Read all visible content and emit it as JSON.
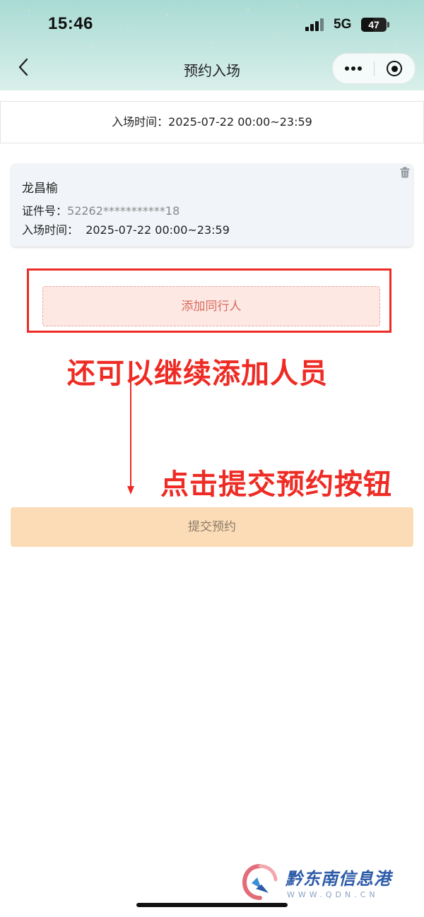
{
  "status_bar": {
    "time": "15:46",
    "network": "5G",
    "battery": "47",
    "battery_level": 0.47
  },
  "nav": {
    "title": "预约入场",
    "back_icon": "chevron-left-icon",
    "more_icon": "more-dots-icon",
    "close_icon": "target-circle-icon"
  },
  "entry_time": {
    "label": "入场时间：",
    "value": "2025-07-22 00:00~23:59"
  },
  "visitor": {
    "name": "龙昌榆",
    "id_label": "证件号：",
    "id_value": "52262***********18",
    "time_label": "入场时间：",
    "time_value": "2025-07-22 00:00~23:59",
    "delete_icon": "trash-icon"
  },
  "buttons": {
    "add_companion": "添加同行人",
    "submit": "提交预约"
  },
  "annotations": {
    "continue_adding": "还可以继续添加人员",
    "click_submit": "点击提交预约按钮"
  },
  "watermark": {
    "name": "黔东南信息港",
    "url": "WWW.QDN.CN"
  },
  "colors": {
    "annotation_red": "#ef2b25",
    "add_button_bg": "#fde8e4",
    "add_button_text": "#d96b5d",
    "submit_bg": "#fcdcb6",
    "card_bg": "#f1f5f9"
  }
}
